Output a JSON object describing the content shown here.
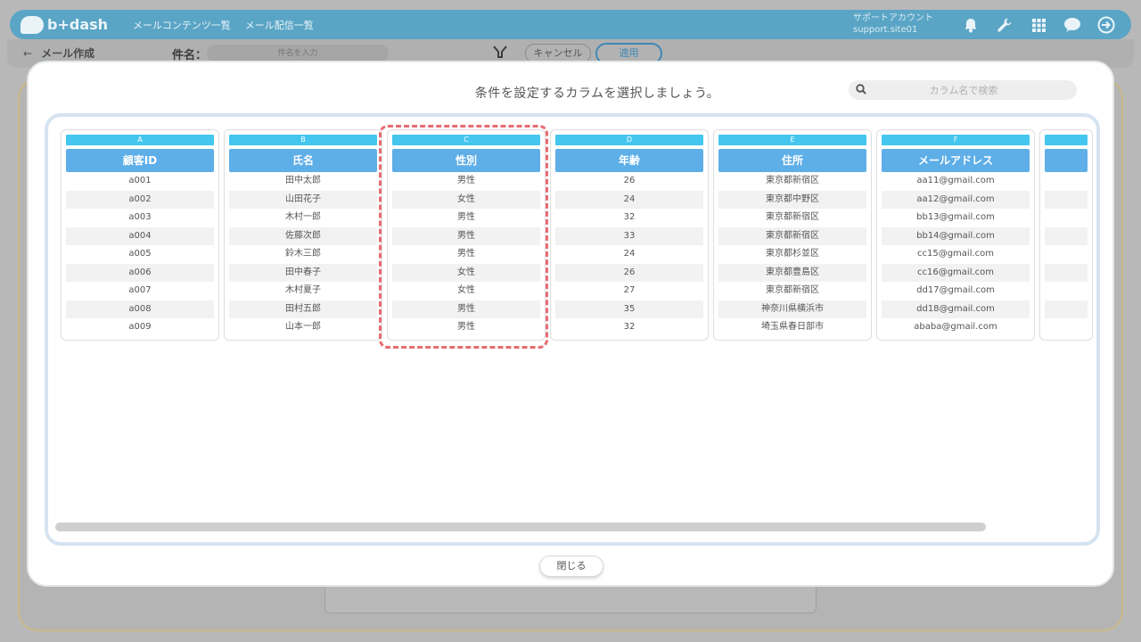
{
  "header": {
    "logo_text": "b+dash",
    "nav": [
      "メールコンテンツ一覧",
      "メール配信一覧"
    ],
    "account_label": "サポートアカウント",
    "account_site": "support.site01",
    "icons": [
      "bell-icon",
      "wrench-icon",
      "grid-icon",
      "chat-icon",
      "logout-icon"
    ]
  },
  "subbar": {
    "back_label": "←",
    "title": "メール作成",
    "subject_label": "件名：",
    "subject_placeholder": "件名を入力",
    "cancel_label": "キャンセル",
    "apply_label": "適用"
  },
  "modal": {
    "title": "条件を設定するカラムを選択しましょう。",
    "search_placeholder": "カラム名で検索",
    "close_label": "閉じる",
    "selected_column": "C"
  },
  "columns": [
    {
      "letter": "A",
      "name": "顧客ID",
      "values": [
        "a001",
        "a002",
        "a003",
        "a004",
        "a005",
        "a006",
        "a007",
        "a008",
        "a009"
      ]
    },
    {
      "letter": "B",
      "name": "氏名",
      "values": [
        "田中太郎",
        "山田花子",
        "木村一郎",
        "佐藤次郎",
        "鈴木三郎",
        "田中春子",
        "木村夏子",
        "田村五郎",
        "山本一郎"
      ]
    },
    {
      "letter": "C",
      "name": "性別",
      "values": [
        "男性",
        "女性",
        "男性",
        "男性",
        "男性",
        "女性",
        "女性",
        "男性",
        "男性"
      ]
    },
    {
      "letter": "D",
      "name": "年齢",
      "values": [
        "26",
        "24",
        "32",
        "33",
        "24",
        "26",
        "27",
        "35",
        "32"
      ]
    },
    {
      "letter": "E",
      "name": "住所",
      "values": [
        "東京都新宿区",
        "東京都中野区",
        "東京都新宿区",
        "東京都新宿区",
        "東京都杉並区",
        "東京都豊島区",
        "東京都新宿区",
        "神奈川県横浜市",
        "埼玉県春日部市"
      ]
    },
    {
      "letter": "F",
      "name": "メールアドレス",
      "values": [
        "aa11@gmail.com",
        "aa12@gmail.com",
        "bb13@gmail.com",
        "bb14@gmail.com",
        "cc15@gmail.com",
        "cc16@gmail.com",
        "dd17@gmail.com",
        "dd18@gmail.com",
        "ababa@gmail.com"
      ]
    }
  ],
  "colors": {
    "header_bg": "#5aa5c6",
    "column_letter_bg": "#44c6ef",
    "column_name_bg": "#5eaee7",
    "selection_border": "#e86c72"
  }
}
